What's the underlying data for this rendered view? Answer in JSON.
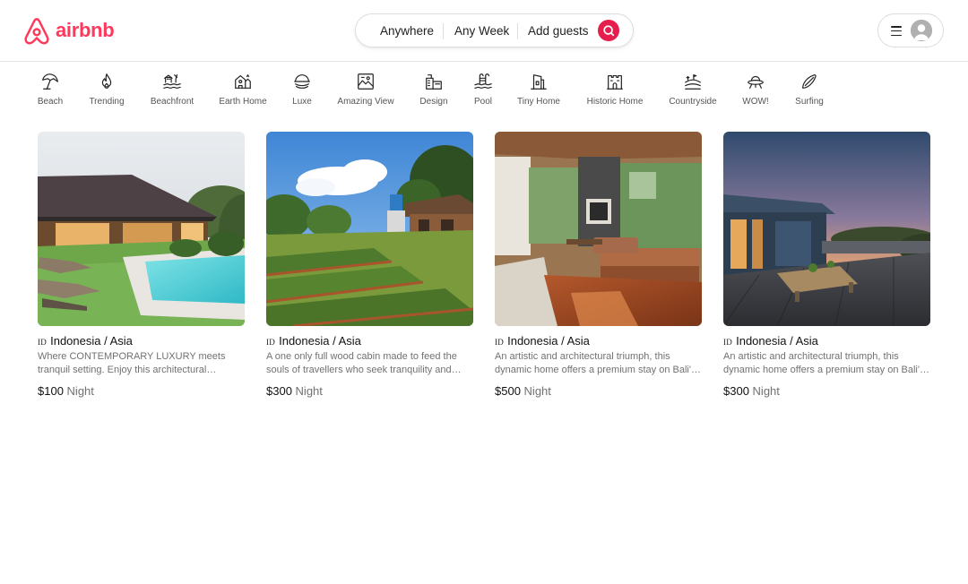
{
  "brand": {
    "name": "airbnb",
    "color": "#ff385c"
  },
  "search": {
    "location": "Anywhere",
    "week": "Any Week",
    "guests": "Add guests",
    "button_color": "#e61e4d"
  },
  "user_menu": {
    "menu_icon": "hamburger-icon",
    "avatar_icon": "user-avatar-icon"
  },
  "categories": [
    {
      "label": "Beach",
      "icon": "beach-umbrella-icon"
    },
    {
      "label": "Trending",
      "icon": "flame-icon"
    },
    {
      "label": "Beachfront",
      "icon": "beachfront-icon"
    },
    {
      "label": "Earth Home",
      "icon": "earth-home-icon"
    },
    {
      "label": "Luxe",
      "icon": "luxe-icon"
    },
    {
      "label": "Amazing View",
      "icon": "amazing-view-icon"
    },
    {
      "label": "Design",
      "icon": "design-icon"
    },
    {
      "label": "Pool",
      "icon": "pool-icon"
    },
    {
      "label": "Tiny Home",
      "icon": "tiny-home-icon"
    },
    {
      "label": "Historic Home",
      "icon": "historic-home-icon"
    },
    {
      "label": "Countryside",
      "icon": "countryside-icon"
    },
    {
      "label": "WOW!",
      "icon": "ufo-icon"
    },
    {
      "label": "Surfing",
      "icon": "surfboard-icon"
    }
  ],
  "listings": [
    {
      "flag": "ID",
      "location": "Indonesia / Asia",
      "description": "Where CONTEMPORARY LUXURY meets tranquil setting. Enjoy this architectural masterpiece",
      "price": "$100",
      "unit": "Night"
    },
    {
      "flag": "ID",
      "location": "Indonesia / Asia",
      "description": "A one only full wood cabin made to feed the souls of travellers who seek tranquility and nature",
      "price": "$300",
      "unit": "Night"
    },
    {
      "flag": "ID",
      "location": "Indonesia / Asia",
      "description": "An artistic and architectural triumph, this dynamic home offers a premium stay on Bali's coast",
      "price": "$500",
      "unit": "Night"
    },
    {
      "flag": "ID",
      "location": "Indonesia / Asia",
      "description": "An artistic and architectural triumph, this dynamic home offers a premium stay on Bali's coast",
      "price": "$300",
      "unit": "Night"
    }
  ]
}
